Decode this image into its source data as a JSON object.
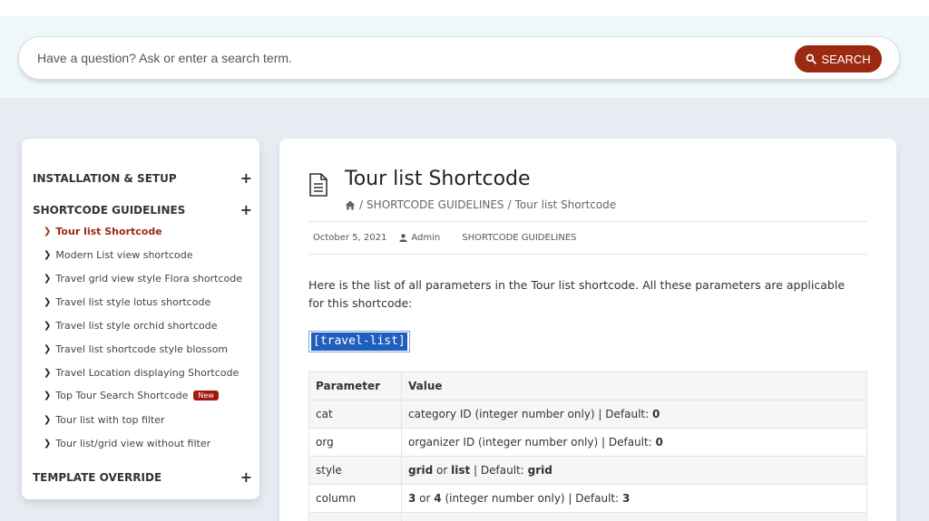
{
  "search": {
    "placeholder": "Have a question? Ask or enter a search term.",
    "button_label": "SEARCH"
  },
  "sidebar": {
    "sections": [
      {
        "label": "INSTALLATION & SETUP",
        "toggle": "+"
      },
      {
        "label": "SHORTCODE GUIDELINES",
        "toggle": "+"
      },
      {
        "label": "TEMPLATE OVERRIDE",
        "toggle": "+"
      }
    ],
    "items": [
      {
        "label": "Tour list Shortcode",
        "active": true
      },
      {
        "label": "Modern List view shortcode"
      },
      {
        "label": "Travel grid view style Flora shortcode"
      },
      {
        "label": "Travel list style lotus shortcode"
      },
      {
        "label": "Travel list style orchid shortcode"
      },
      {
        "label": "Travel list shortcode style blossom"
      },
      {
        "label": "Travel Location displaying Shortcode"
      },
      {
        "label": "Top Tour Search Shortcode",
        "badge": "New"
      },
      {
        "label": "Tour list with top filter"
      },
      {
        "label": "Tour list/grid view without filter"
      }
    ]
  },
  "article": {
    "title": "Tour list Shortcode",
    "breadcrumb": {
      "sep": "/",
      "section": "SHORTCODE GUIDELINES",
      "current": "Tour list Shortcode"
    },
    "meta": {
      "date": "October 5, 2021",
      "author": "Admin",
      "category": "SHORTCODE GUIDELINES"
    },
    "intro": "Here is the list of all parameters in the Tour list shortcode. All these parameters are applicable for this shortcode:",
    "shortcode": "[travel-list]"
  },
  "table": {
    "headers": [
      "Parameter",
      "Value"
    ],
    "rows": [
      {
        "param": "cat",
        "v1": "category ID (integer number only) | Default: ",
        "v1b": "0"
      },
      {
        "param": "org",
        "v1": "organizer ID (integer number only) | Default: ",
        "v1b": "0"
      },
      {
        "param": "style",
        "b1": "grid",
        "t1": " or ",
        "b2": "list",
        "t2": " | Default: ",
        "b3": "grid"
      },
      {
        "param": "column",
        "b1": "3",
        "t1": " or ",
        "b2": "4",
        "t2": " (integer number only) | Default: ",
        "b3": "3"
      }
    ]
  },
  "colors": {
    "accent": "#9b2a11",
    "badge": "#a4180f",
    "selection": "#1f5dbf"
  },
  "icons": [
    "search-icon",
    "plus-icon",
    "chevron-right-icon",
    "document-icon",
    "home-icon",
    "user-icon"
  ]
}
